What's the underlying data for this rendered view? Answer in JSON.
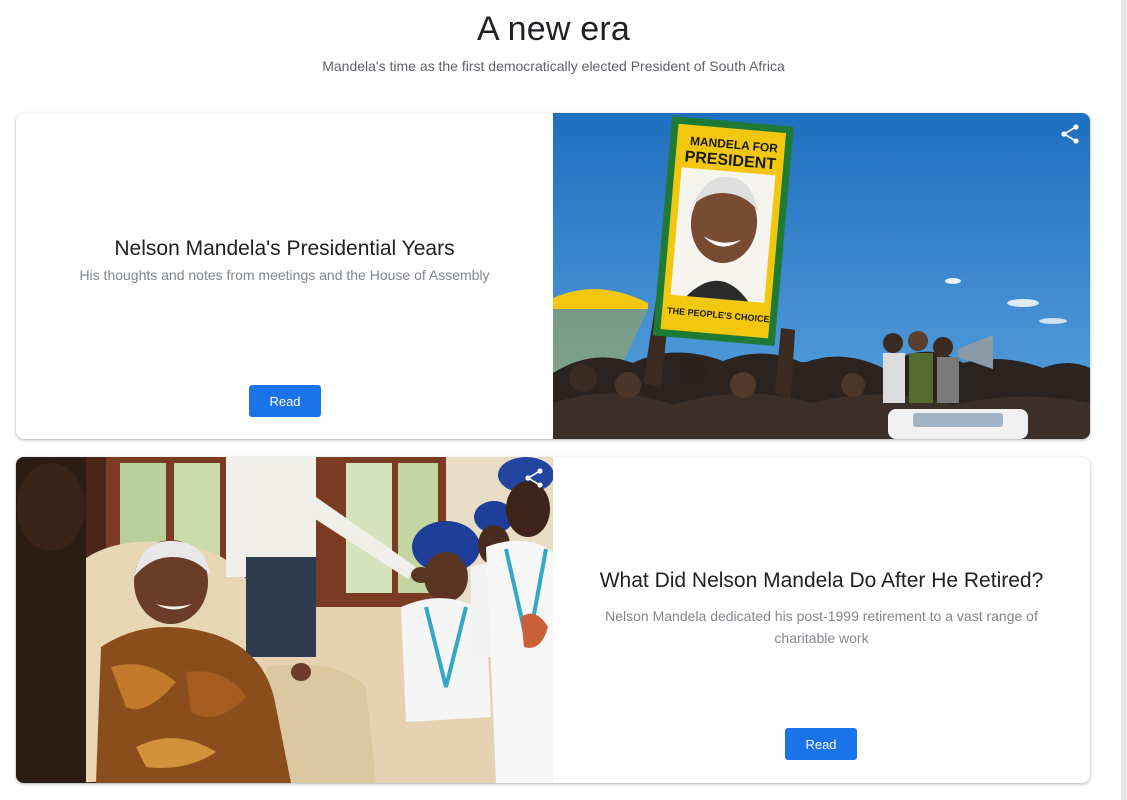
{
  "header": {
    "title": "A new era",
    "subtitle": "Mandela's time as the first democratically elected President of South Africa"
  },
  "cards": [
    {
      "title": "Nelson Mandela's Presidential Years",
      "description": "His thoughts and notes from meetings and the House of Assembly",
      "button_label": "Read",
      "image": {
        "poster_line1": "MANDELA FOR",
        "poster_line2": "PRESIDENT",
        "poster_footer": "THE PEOPLE'S CHOICE"
      },
      "share_icon": "share-icon"
    },
    {
      "title": "What Did Nelson Mandela Do After He Retired?",
      "description": "Nelson Mandela dedicated his post-1999 retirement to a vast range of charitable work",
      "button_label": "Read",
      "share_icon": "share-icon"
    }
  ],
  "colors": {
    "accent": "#1a73e8",
    "sky": "#2f7fc9",
    "poster_green": "#1f7a34",
    "poster_yellow": "#f2c80f"
  }
}
